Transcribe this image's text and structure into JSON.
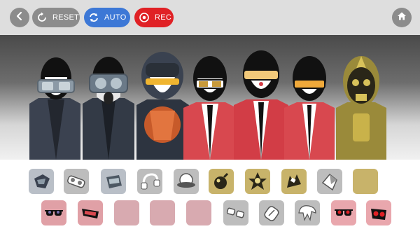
{
  "toolbar": {
    "back_label": "",
    "reset_label": "RESET",
    "auto_label": "AUTO",
    "rec_label": "REC"
  },
  "colors": {
    "neutral_button": "#8c8c8c",
    "auto_button": "#3d78d6",
    "rec_button": "#e02125",
    "home_button": "#8c8c8c",
    "effects_slot": "#bdbdbd",
    "beats_slot": "#c8b36a",
    "melody_slot": "#d8aab0",
    "voices_slot": "#e9a7ad"
  },
  "performers": [
    {
      "name": "performer-1",
      "style": "goggles-blue"
    },
    {
      "name": "performer-2",
      "style": "gasmask-blue"
    },
    {
      "name": "performer-3",
      "style": "helmet-orange"
    },
    {
      "name": "performer-4",
      "style": "red-jacket-shades"
    },
    {
      "name": "performer-5",
      "style": "red-jacket-orange-glasses"
    },
    {
      "name": "performer-6",
      "style": "red-jacket-orange-glasses"
    },
    {
      "name": "performer-7",
      "style": "gold-mask"
    }
  ],
  "sound_icons_row1": [
    {
      "icon": "helmet-icon",
      "category": "effects"
    },
    {
      "icon": "goggles-icon",
      "category": "effects"
    },
    {
      "icon": "mask-icon",
      "category": "effects"
    },
    {
      "icon": "headphones-icon",
      "category": "effects"
    },
    {
      "icon": "hat-icon",
      "category": "effects"
    },
    {
      "icon": "bomb-icon",
      "category": "beats"
    },
    {
      "icon": "star-icon",
      "category": "beats"
    },
    {
      "icon": "crown-icon",
      "category": "beats"
    },
    {
      "icon": "shard-icon",
      "category": "effects"
    },
    {
      "icon": "empty-slot",
      "category": "beats"
    }
  ],
  "sound_icons_row2": [
    {
      "icon": "sunglasses-icon",
      "category": "voices"
    },
    {
      "icon": "visor-icon",
      "category": "voices"
    },
    {
      "icon": "empty-slot",
      "category": "melody"
    },
    {
      "icon": "empty-slot",
      "category": "melody"
    },
    {
      "icon": "empty-slot",
      "category": "melody"
    },
    {
      "icon": "glasses-icon",
      "category": "effects"
    },
    {
      "icon": "microphone-icon",
      "category": "effects"
    },
    {
      "icon": "hair-icon",
      "category": "effects"
    },
    {
      "icon": "red-sunglasses-icon",
      "category": "voices"
    },
    {
      "icon": "red-mask-icon",
      "category": "voices"
    }
  ]
}
